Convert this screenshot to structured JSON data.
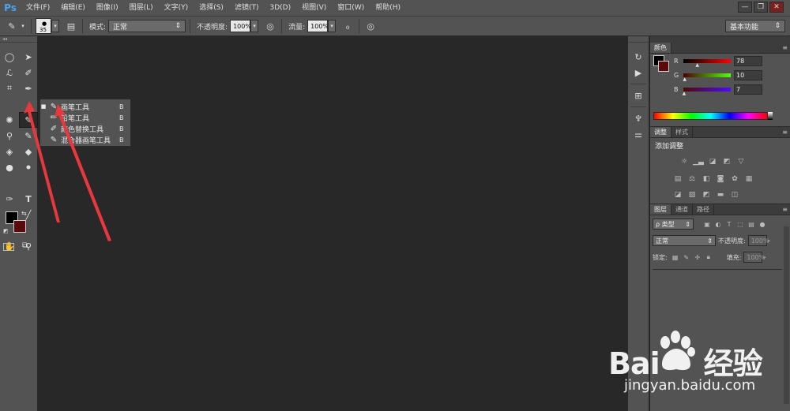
{
  "app": {
    "logo": "Ps",
    "menu": [
      "文件(F)",
      "编辑(E)",
      "图像(I)",
      "图层(L)",
      "文字(Y)",
      "选择(S)",
      "滤镜(T)",
      "3D(D)",
      "视图(V)",
      "窗口(W)",
      "帮助(H)"
    ],
    "window_controls": [
      "—",
      "❐",
      "✕"
    ]
  },
  "options": {
    "brush_size": "35",
    "mode_label": "模式:",
    "mode_value": "正常",
    "opacity_label": "不透明度:",
    "opacity_value": "100%",
    "flow_label": "流量:",
    "flow_value": "100%",
    "workspace": "基本功能"
  },
  "flyout": {
    "items": [
      {
        "label": "画笔工具",
        "key": "B",
        "active": true,
        "icon": "brush-icon"
      },
      {
        "label": "铅笔工具",
        "key": "B",
        "active": false,
        "icon": "pencil-icon"
      },
      {
        "label": "颜色替换工具",
        "key": "B",
        "active": false,
        "icon": "color-replace-icon"
      },
      {
        "label": "混合器画笔工具",
        "key": "B",
        "active": false,
        "icon": "mixer-brush-icon"
      }
    ]
  },
  "color_panel": {
    "tab": "颜色",
    "channels": [
      {
        "label": "R",
        "value": "78",
        "gradient": [
          "#000000",
          "#ff0000"
        ],
        "level": 0.306
      },
      {
        "label": "G",
        "value": "10",
        "gradient": [
          "#4e0000",
          "#4eff00"
        ],
        "level": 0.039
      },
      {
        "label": "B",
        "value": "7",
        "gradient": [
          "#4e0a00",
          "#4e0aff"
        ],
        "level": 0.027
      }
    ],
    "fg_color": "#000000",
    "bg_color": "#5a0a0a"
  },
  "adjust_panel": {
    "tabs": [
      "调整",
      "样式"
    ],
    "title": "添加调整"
  },
  "layers_panel": {
    "tabs": [
      "图层",
      "通道",
      "路径"
    ],
    "filter_label": "ρ 类型",
    "blend_mode": "正常",
    "opacity_label": "不透明度:",
    "opacity_value": "100%",
    "lock_label": "锁定:",
    "fill_label": "填充:",
    "fill_value": "100%"
  },
  "watermark": {
    "logo_left": "Bai",
    "logo_right": "经验",
    "url": "jingyan.baidu.com"
  },
  "colors": {
    "accent": "#4aa3f0",
    "arrow": "#e8383d",
    "chrome": "#535353",
    "canvas": "#282828"
  }
}
